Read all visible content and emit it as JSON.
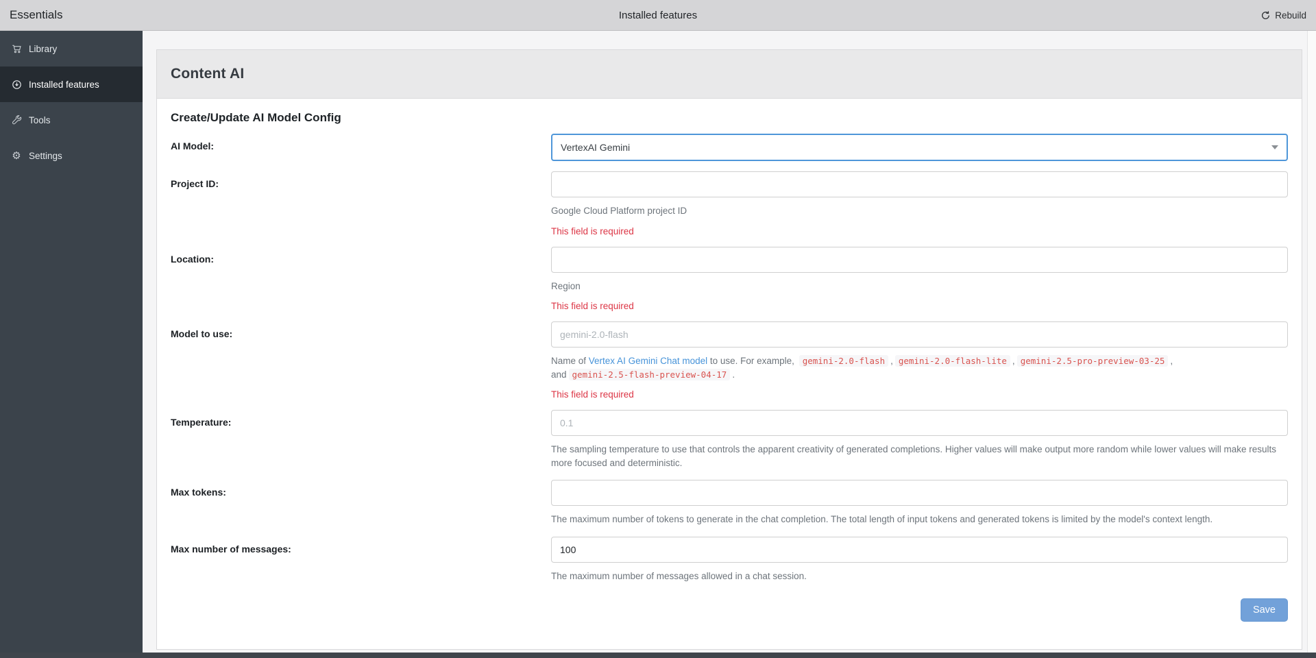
{
  "topbar": {
    "app_title": "Essentials",
    "page_title": "Installed features",
    "rebuild_label": "Rebuild"
  },
  "sidebar": {
    "items": [
      {
        "label": "Library",
        "icon": "cart-icon",
        "active": false
      },
      {
        "label": "Installed features",
        "icon": "circle-down-arrow-icon",
        "active": true
      },
      {
        "label": "Tools",
        "icon": "wrench-icon",
        "active": false
      },
      {
        "label": "Settings",
        "icon": "gear-icon",
        "active": false
      }
    ]
  },
  "content": {
    "section_title": "Content AI",
    "form_title": "Create/Update AI Model Config",
    "save_label": "Save",
    "fields": [
      {
        "label": "AI Model:",
        "control": "select",
        "value": "VertexAI Gemini"
      },
      {
        "label": "Project ID:",
        "control": "input",
        "value": "",
        "help": "Google Cloud Platform project ID",
        "error": "This field is required"
      },
      {
        "label": "Location:",
        "control": "input",
        "value": "",
        "help": "Region",
        "error": "This field is required"
      },
      {
        "label": "Model to use:",
        "control": "input",
        "value": "",
        "placeholder": "gemini-2.0-flash",
        "help_prefix": "Name of ",
        "help_link": "Vertex AI Gemini Chat model",
        "help_mid": " to use. For example, ",
        "codes": [
          "gemini-2.0-flash",
          "gemini-2.0-flash-lite",
          "gemini-2.5-pro-preview-03-25",
          "gemini-2.5-flash-preview-04-17"
        ],
        "sep": ",",
        "sep_and": ", and",
        "help_suffix": ".",
        "error": "This field is required"
      },
      {
        "label": "Temperature:",
        "control": "input",
        "value": "",
        "placeholder": "0.1",
        "help": "The sampling temperature to use that controls the apparent creativity of generated completions. Higher values will make output more random while lower values will make results more focused and deterministic."
      },
      {
        "label": "Max tokens:",
        "control": "input",
        "value": "",
        "help": "The maximum number of tokens to generate in the chat completion. The total length of input tokens and generated tokens is limited by the model's context length."
      },
      {
        "label": "Max number of messages:",
        "control": "input",
        "value": "100",
        "help": "The maximum number of messages allowed in a chat session."
      }
    ]
  },
  "colors": {
    "accent_blue": "#4e96d9",
    "link_blue": "#4693d9",
    "error_red": "#dc3545",
    "code_red": "#d9534f",
    "save_button_blue": "#72a1d9",
    "sidebar_bg": "#3b434b",
    "sidebar_active_bg": "#252b31",
    "topbar_bg": "#d5d5d7",
    "section_header_bg": "#e9e9ea"
  }
}
